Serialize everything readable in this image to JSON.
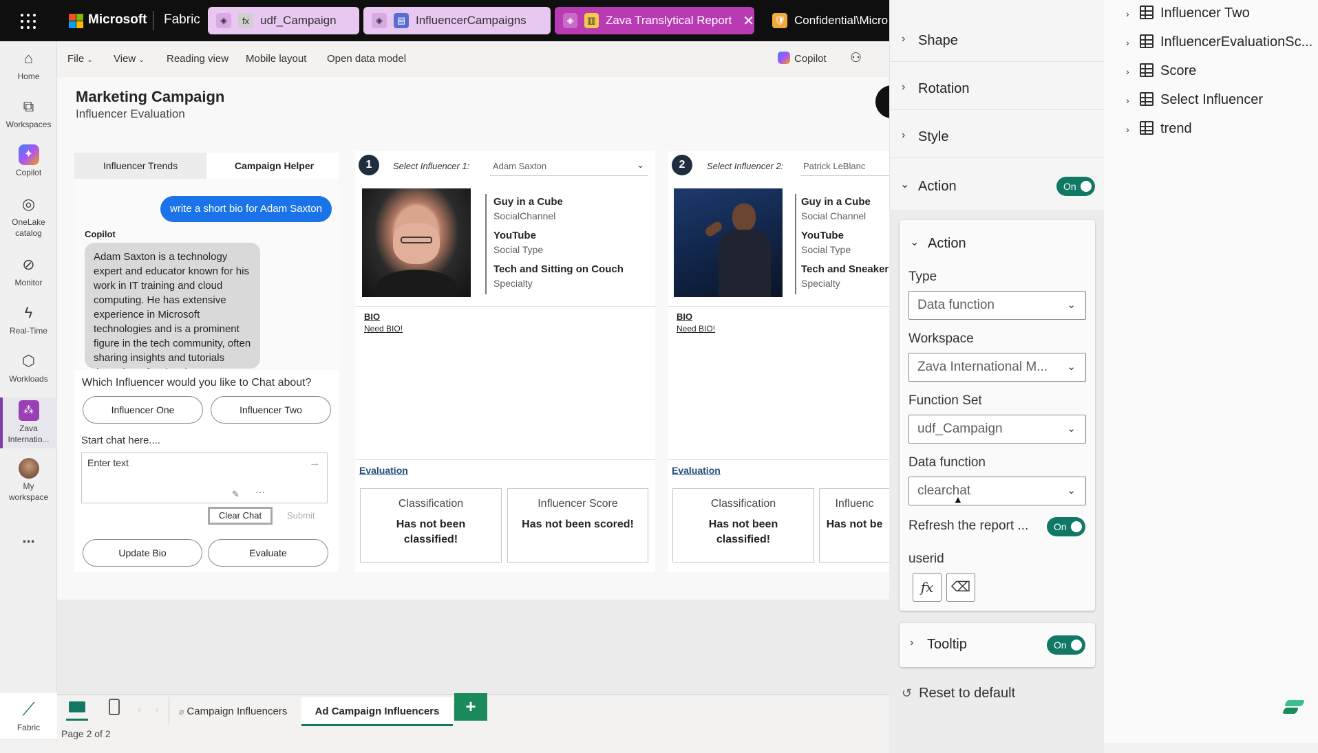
{
  "topbar": {
    "brand": "Microsoft",
    "app": "Fabric",
    "tabs": [
      {
        "label": "udf_Campaign",
        "color": "#e8c7f0"
      },
      {
        "label": "InfluencerCampaigns",
        "color": "#e8c7f0"
      },
      {
        "label": "Zava Translytical Report",
        "color": "#b93bb4"
      },
      {
        "label": "Confidential\\Micro",
        "color": "#0f0f10"
      }
    ]
  },
  "rail": {
    "items": [
      {
        "label": "Home",
        "icon": "home-icon"
      },
      {
        "label": "Workspaces",
        "icon": "workspaces-icon"
      },
      {
        "label": "Copilot",
        "icon": "copilot-icon"
      },
      {
        "label": "OneLake catalog",
        "icon": "onelake-icon"
      },
      {
        "label": "Monitor",
        "icon": "monitor-icon"
      },
      {
        "label": "Real-Time",
        "icon": "lightning-icon"
      },
      {
        "label": "Workloads",
        "icon": "workloads-icon"
      },
      {
        "label": "Zava Internatio...",
        "icon": "zava-icon"
      },
      {
        "label": "My workspace",
        "icon": "avatar-icon"
      },
      {
        "label": "...",
        "icon": "more-icon"
      }
    ],
    "footer": "Fabric"
  },
  "toolbar": {
    "file": "File",
    "view": "View",
    "reading": "Reading view",
    "mobile": "Mobile layout",
    "open_model": "Open data model",
    "copilot": "Copilot"
  },
  "report": {
    "title": "Marketing Campaign",
    "subtitle": "Influencer Evaluation"
  },
  "chat": {
    "tab_trends": "Influencer Trends",
    "tab_helper": "Campaign Helper",
    "user_msg": "write a short bio for Adam Saxton",
    "bot_label": "Copilot",
    "bot_msg": "Adam Saxton is a technology expert and educator known for his work in IT training and cloud computing. He has extensive experience in Microsoft technologies and is a prominent figure in the tech community, often sharing insights and tutorials through professional",
    "question": "Which Influencer would you like to Chat about?",
    "btn_one": "Influencer One",
    "btn_two": "Influencer Two",
    "start_label": "Start chat here....",
    "input_placeholder": "Enter text",
    "clear": "Clear Chat",
    "submit": "Submit",
    "update_bio": "Update Bio",
    "evaluate": "Evaluate"
  },
  "influencer1": {
    "num": "1",
    "label": "Select Influencer 1:",
    "name": "Adam Saxton",
    "channel": "Guy in a Cube",
    "channel_sub": "SocialChannel",
    "type": "YouTube",
    "type_sub": "Social Type",
    "specialty": "Tech and Sitting on Couch",
    "specialty_sub": "Specialty",
    "bio_h": "BIO",
    "bio": "Need BIO!",
    "eval_h": "Evaluation",
    "class_t": "Classification",
    "class_v1": "Has not been",
    "class_v2": "classified!",
    "score_t": "Influencer Score",
    "score_v": "Has not been scored!"
  },
  "influencer2": {
    "num": "2",
    "label": "Select Influencer 2:",
    "name": "Patrick LeBlanc",
    "channel": "Guy in a Cube",
    "channel_sub": "Social Channel",
    "type": "YouTube",
    "type_sub": "Social Type",
    "specialty": "Tech and Sneakers",
    "specialty_sub": "Specialty",
    "bio_h": "BIO",
    "bio": "Need BIO!",
    "eval_h": "Evaluation",
    "class_t": "Classification",
    "class_v1": "Has not been",
    "class_v2": "classified!",
    "score_t": "Influenc",
    "score_v": "Has not be"
  },
  "pages": {
    "tab1": "Campaign Influencers",
    "tab2": "Ad Campaign Influencers",
    "add": "+",
    "status": "Page 2 of 2"
  },
  "format": {
    "shape": "Shape",
    "rotation": "Rotation",
    "style": "Style",
    "action": "Action",
    "action_toggle": "On",
    "inner_action": "Action",
    "type_label": "Type",
    "type_value": "Data function",
    "workspace_label": "Workspace",
    "workspace_value": "Zava International M...",
    "fnset_label": "Function Set",
    "fnset_value": "udf_Campaign",
    "datafn_label": "Data function",
    "datafn_value": "clearchat",
    "refresh_label": "Refresh the report ...",
    "refresh_toggle": "On",
    "userid_label": "userid",
    "tooltip": "Tooltip",
    "tooltip_toggle": "On",
    "reset": "Reset to default"
  },
  "data_pane": {
    "fields": [
      "Influencer Two",
      "InfluencerEvaluationSc...",
      "Score",
      "Select Influencer",
      "trend"
    ]
  },
  "colors": {
    "accent": "#117865",
    "active_tab": "#b93bb4",
    "user_bubble": "#1a73e8",
    "add_page": "#1b8a5a"
  }
}
